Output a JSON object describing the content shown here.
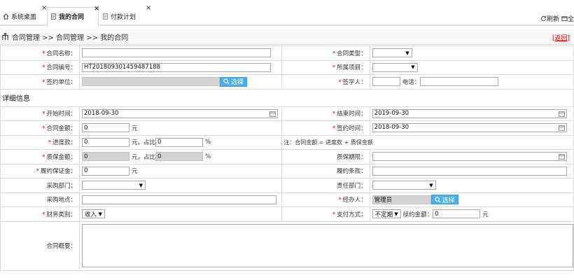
{
  "tabs": [
    {
      "label": "系统桌面",
      "close": "×"
    },
    {
      "label": "我的合同",
      "close": "×"
    },
    {
      "label": "付款计划",
      "close": "×"
    }
  ],
  "toolbar": {
    "refresh": "刷新",
    "fullscreen": "全"
  },
  "breadcrumb": {
    "path": "合同管理 >> 合同管理 >> 我的合同",
    "back_open": "[",
    "back": "返回",
    "back_close": "]"
  },
  "form": {
    "contract_name": {
      "label": "合同名称：",
      "value": ""
    },
    "contract_type": {
      "label": "合同类型：",
      "value": ""
    },
    "contract_no": {
      "label": "合同编号：",
      "value": "HT201809301459487188"
    },
    "project": {
      "label": "所属项目：",
      "value": ""
    },
    "signing_unit": {
      "label": "签约单位：",
      "value": "",
      "button": "选择"
    },
    "signer": {
      "label": "签字人：",
      "value": ""
    },
    "phone": {
      "label": "电话：",
      "value": ""
    }
  },
  "detail": {
    "section_title": "详细信息",
    "start_time": {
      "label": "开始时间：",
      "value": "2018-09-30"
    },
    "end_time": {
      "label": "结束时间：",
      "value": "2019-09-30"
    },
    "amount": {
      "label": "合同金额：",
      "value": "0",
      "unit": "元"
    },
    "sign_time": {
      "label": "签约时间：",
      "value": "2018-09-30"
    },
    "progress_pay": {
      "label": "进度款：",
      "value": "0",
      "unit": "元，占比",
      "ratio": "0",
      "pct": "%"
    },
    "note": "注：合同金额 = 进度款 + 质保金额",
    "warranty_amount": {
      "label": "质保金额：",
      "value": "0",
      "unit": "元，占比",
      "ratio": "0",
      "pct": "%"
    },
    "warranty_period": {
      "label": "质保期限：",
      "value": ""
    },
    "performance_bond": {
      "label": "履约保证金：",
      "value": "0",
      "unit": "元"
    },
    "performance_terms": {
      "label": "履约条款：",
      "value": ""
    },
    "purchase_dept": {
      "label": "采购部门：",
      "value": ""
    },
    "responsible_dept": {
      "label": "责任部门：",
      "value": ""
    },
    "purchase_location": {
      "label": "采购地点：",
      "value": ""
    },
    "handler": {
      "label": "经办人：",
      "value": "管理员",
      "button": "选择"
    },
    "finance_type": {
      "label": "财务类别：",
      "value": "收入"
    },
    "payment_method": {
      "label": "支付方式：",
      "value": "不定期",
      "renew_label": "续约金额：",
      "renew_value": "0",
      "unit": "元"
    },
    "summary": {
      "label": "合同概要："
    }
  },
  "colors": {
    "required": "#e00000",
    "choose_button": "#4ab1e8",
    "back_link": "#cc0000"
  }
}
